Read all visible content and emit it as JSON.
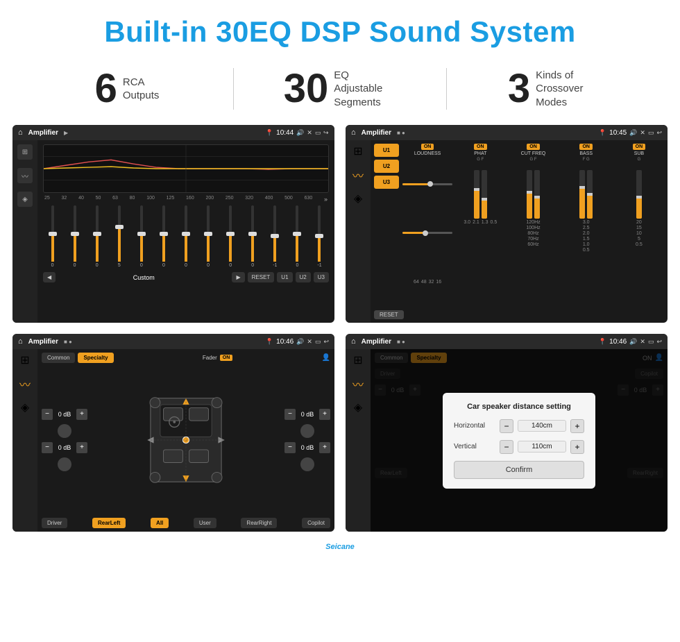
{
  "header": {
    "title": "Built-in 30EQ DSP Sound System"
  },
  "stats": [
    {
      "number": "6",
      "label": "RCA\nOutputs"
    },
    {
      "number": "30",
      "label": "EQ Adjustable\nSegments"
    },
    {
      "number": "3",
      "label": "Kinds of\nCrossover Modes"
    }
  ],
  "screens": {
    "eq": {
      "status_bar": {
        "app": "Amplifier",
        "time": "10:44"
      },
      "freq_labels": [
        "25",
        "32",
        "40",
        "50",
        "63",
        "80",
        "100",
        "125",
        "160",
        "200",
        "250",
        "320",
        "400",
        "500",
        "630"
      ],
      "slider_values": [
        "0",
        "0",
        "0",
        "5",
        "0",
        "0",
        "0",
        "0",
        "0",
        "0",
        "-1",
        "0",
        "-1"
      ],
      "buttons": {
        "prev": "◀",
        "preset": "Custom",
        "next": "▶",
        "reset": "RESET",
        "u1": "U1",
        "u2": "U2",
        "u3": "U3"
      }
    },
    "amp": {
      "status_bar": {
        "app": "Amplifier",
        "time": "10:45"
      },
      "presets": [
        "U1",
        "U2",
        "U3"
      ],
      "sections": [
        {
          "on": true,
          "title": "LOUDNESS",
          "sub": ""
        },
        {
          "on": true,
          "title": "PHAT",
          "sub": "G    F"
        },
        {
          "on": true,
          "title": "CUT FREQ",
          "sub": "G    F"
        },
        {
          "on": true,
          "title": "BASS",
          "sub": "F    G"
        },
        {
          "on": true,
          "title": "SUB",
          "sub": "G"
        }
      ],
      "reset_label": "RESET"
    },
    "speaker": {
      "status_bar": {
        "app": "Amplifier",
        "time": "10:46"
      },
      "tabs": [
        "Common",
        "Specialty"
      ],
      "active_tab": 1,
      "fader_label": "Fader",
      "on_badge": "ON",
      "positions": {
        "driver": "Driver",
        "rear_left": "RearLeft",
        "all": "All",
        "user": "User",
        "rear_right": "RearRight",
        "copilot": "Copilot"
      },
      "vol_labels": [
        "0 dB",
        "0 dB",
        "0 dB",
        "0 dB"
      ]
    },
    "distance": {
      "status_bar": {
        "app": "Amplifier",
        "time": "10:46"
      },
      "tabs": [
        "Common",
        "Specialty"
      ],
      "active_tab": 1,
      "modal": {
        "title": "Car speaker distance setting",
        "horizontal_label": "Horizontal",
        "horizontal_value": "140cm",
        "vertical_label": "Vertical",
        "vertical_value": "110cm",
        "confirm_label": "Confirm"
      },
      "positions": {
        "driver": "Driver",
        "rear_left": "RearLeft",
        "copilot": "Copilot",
        "rear_right": "RearRight"
      },
      "vol_labels": [
        "0 dB",
        "0 dB"
      ]
    }
  },
  "watermark": "Seicane"
}
